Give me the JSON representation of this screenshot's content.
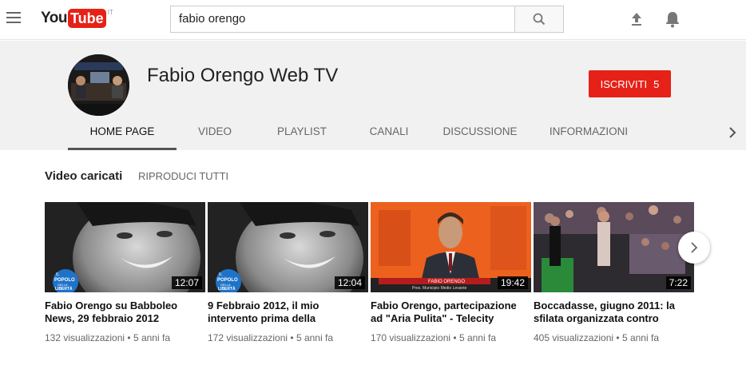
{
  "header": {
    "logo": "You Tube",
    "logo_you": "You",
    "logo_tube": "Tube",
    "country": "IT",
    "search_value": "fabio orengo"
  },
  "channel": {
    "title": "Fabio Orengo Web TV",
    "subscribe_label": "ISCRIVITI",
    "subscriber_count": "5",
    "tabs": [
      "HOME PAGE",
      "VIDEO",
      "PLAYLIST",
      "CANALI",
      "DISCUSSIONE",
      "INFORMAZIONI"
    ],
    "active_tab": "HOME PAGE"
  },
  "section": {
    "title": "Video caricati",
    "play_all": "RIPRODUCI TUTTI"
  },
  "videos": [
    {
      "title": "Fabio Orengo su Babboleo News, 29 febbraio 2012",
      "duration": "12:07",
      "views": "132 visualizzazioni",
      "age": "5 anni fa"
    },
    {
      "title": "9 Febbraio 2012, il mio intervento prima della",
      "duration": "12:04",
      "views": "172 visualizzazioni",
      "age": "5 anni fa"
    },
    {
      "title": "Fabio Orengo, partecipazione ad \"Aria Pulita\" - Telecity",
      "duration": "19:42",
      "views": "170 visualizzazioni",
      "age": "5 anni fa"
    },
    {
      "title": "Boccadasse, giugno 2011: la sfilata organizzata contro",
      "duration": "7:22",
      "views": "405 visualizzazioni",
      "age": "5 anni fa"
    }
  ],
  "meta_separator": "•",
  "thumb_texts": {
    "popolo_1": "IL",
    "popolo_2": "POPOLO",
    "popolo_3": "DELLA",
    "popolo_4": "LIBERTÀ",
    "lower_third_name": "FABIO ORENGO",
    "lower_third_role": "Pres. Municipio Medio Levante"
  },
  "colors": {
    "brand_red": "#e62117",
    "header_bg": "#f1f1f1"
  },
  "icons": {
    "menu": "hamburger-menu-icon",
    "search": "search-icon",
    "upload": "upload-icon",
    "notifications": "bell-icon",
    "tabs_next": "chevron-right-icon",
    "carousel_next": "chevron-right-icon"
  }
}
